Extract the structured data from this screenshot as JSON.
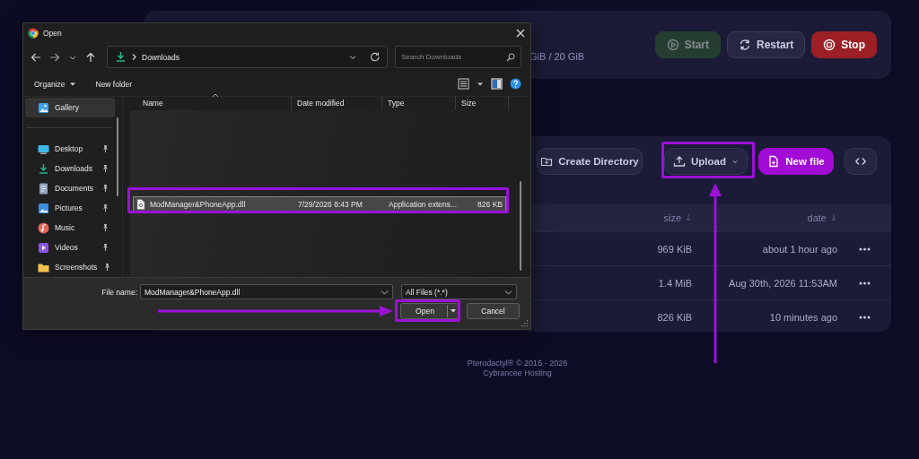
{
  "page": {
    "disk_usage": "GiB / 20 GiB",
    "power_buttons": [
      {
        "label": "Start",
        "kind": "start",
        "disabled": true
      },
      {
        "label": "Restart",
        "kind": "restart",
        "disabled": false
      },
      {
        "label": "Stop",
        "kind": "stop",
        "disabled": false
      }
    ],
    "file_actions": [
      {
        "label": "Create Directory",
        "kind": "folder"
      },
      {
        "label": "Upload",
        "kind": "upload"
      },
      {
        "label": "New file",
        "kind": "new-file"
      },
      {
        "kind": "code"
      }
    ],
    "table": {
      "columns": [
        "size",
        "date"
      ],
      "rows": [
        {
          "size": "969 KiB",
          "date": "about 1 hour ago"
        },
        {
          "size": "1.4 MiB",
          "date": "Aug 30th, 2026 11:53AM"
        },
        {
          "size": "826 KiB",
          "date": "10 minutes ago"
        }
      ]
    },
    "footer": [
      "Pterodactyl® © 2015 - 2026",
      "Cybrancee Hosting"
    ]
  },
  "dialog": {
    "title": "Open",
    "address": "Downloads",
    "search": {
      "placeholder": "Search Downloads"
    },
    "toolbar": [
      "Organize",
      "New folder"
    ],
    "sidebar": [
      {
        "label": "Gallery",
        "selected": true,
        "pinned": false
      },
      {
        "label": "Desktop",
        "selected": false,
        "pinned": true
      },
      {
        "label": "Downloads",
        "selected": false,
        "pinned": true
      },
      {
        "label": "Documents",
        "selected": false,
        "pinned": true
      },
      {
        "label": "Pictures",
        "selected": false,
        "pinned": true
      },
      {
        "label": "Music",
        "selected": false,
        "pinned": true
      },
      {
        "label": "Videos",
        "selected": false,
        "pinned": true
      },
      {
        "label": "Screenshots",
        "selected": false,
        "pinned": true
      }
    ],
    "columns": [
      "Name",
      "Date modified",
      "Type",
      "Size"
    ],
    "files": [
      {
        "name": "ModManager&PhoneApp.dll",
        "date": "7/29/2026 8:43 PM",
        "type": "Application extens...",
        "size": "826 KB",
        "selected": true
      }
    ],
    "file_name_label": "File name:",
    "file_name": "ModManager&PhoneApp.dll",
    "filter": "All Files (*.*)",
    "buttons": [
      {
        "label": "Open",
        "kind": "open"
      },
      {
        "label": "Cancel",
        "kind": "cancel"
      }
    ]
  }
}
